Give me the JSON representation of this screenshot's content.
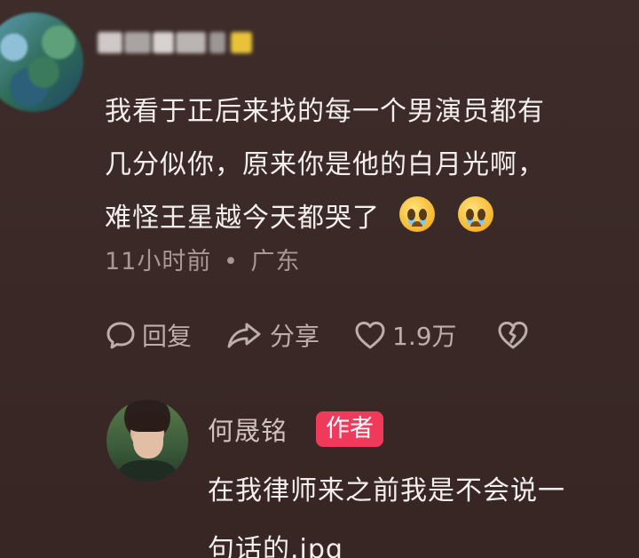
{
  "comment": {
    "username": "",
    "text_line1": "我看于正后来找的每一个男演员都有",
    "text_line2": "几分似你，原来你是他的白月光啊，",
    "text_line3": "难怪王星越今天都哭了",
    "emoji": "crying-face-emoji",
    "time": "11小时前",
    "separator": "•",
    "location": "广东"
  },
  "actions": {
    "reply_label": "回复",
    "share_label": "分享",
    "like_count": "1.9万"
  },
  "reply": {
    "author_name": "何晟铭",
    "author_badge": "作者",
    "text_line1": "在我律师来之前我是不会说一",
    "text_line2": "句话的.jpg"
  },
  "colors": {
    "background": "#3a2a28",
    "badge": "#f03a5c",
    "meta_text": "#a79895"
  }
}
